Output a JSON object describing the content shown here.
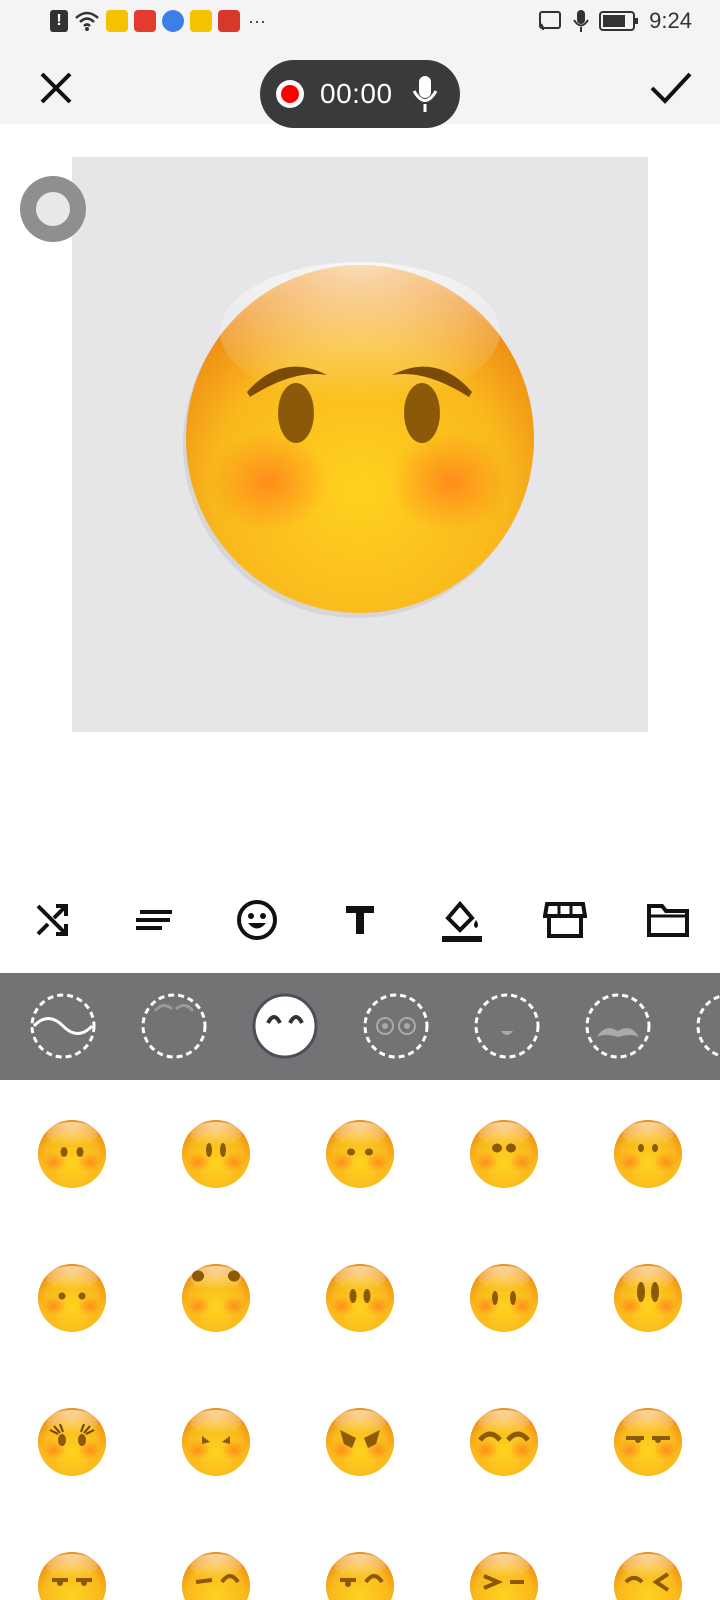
{
  "status_bar": {
    "time": "9:24",
    "icons": [
      "alert-icon",
      "wifi-icon",
      "weibo-icon",
      "app-icon",
      "browser-icon",
      "weibo-icon",
      "app-icon",
      "more-icon"
    ],
    "right_icons": [
      "cast-icon",
      "mic-icon",
      "battery-icon"
    ]
  },
  "top_bar": {
    "recording_time": "00:00",
    "icons": [
      "close-icon",
      "record-icon",
      "microphone-icon",
      "check-icon"
    ]
  },
  "tools": [
    "shuffle-icon",
    "text-align-icon",
    "emoji-icon",
    "text-icon",
    "fill-color-icon",
    "store-icon",
    "folder-icon"
  ],
  "categories": [
    "face-outline",
    "eyebrows",
    "eyes-shape",
    "eyes",
    "mouth",
    "mustache",
    "more"
  ],
  "selected_category": 2,
  "colors": {
    "status_bg": "#f4f4f4",
    "pill_bg": "#3a3a3a",
    "record_red": "#ff0000",
    "canvas_bg": "#e6e5e7",
    "category_strip": "#737275",
    "emoji_yellow": "#fbc02d",
    "blush": "#ff8a1c"
  }
}
